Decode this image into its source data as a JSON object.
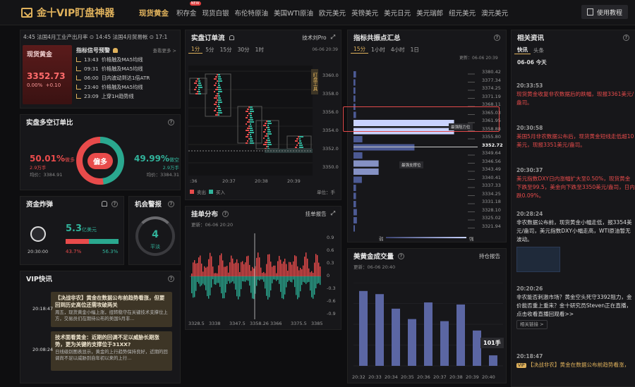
{
  "app": {
    "title": "金十VIP盯盘神器",
    "tutorial": "使用教程"
  },
  "nav": {
    "tabs": [
      {
        "label": "现货黄金",
        "active": true
      },
      {
        "label": "积存金",
        "new": "NEW"
      },
      {
        "label": "现货白银"
      },
      {
        "label": "布伦特原油"
      },
      {
        "label": "美国WTI原油"
      },
      {
        "label": "欧元美元"
      },
      {
        "label": "英镑美元"
      },
      {
        "label": "美元日元"
      },
      {
        "label": "美元瑞郎"
      },
      {
        "label": "纽元美元"
      },
      {
        "label": "澳元美元"
      }
    ]
  },
  "ticker": {
    "text": "4:45 法国4月工业产出月率  ⊙ 14:45 法国4月贸易帐  ⊙ 17:1"
  },
  "gold": {
    "title": "现货黄金",
    "price": "3352.73",
    "change_pct": "0.00%",
    "change": "+0.10"
  },
  "signals": {
    "title": "指标信号预警",
    "more": "查看更多 >",
    "items": [
      {
        "time": "13:43",
        "text": "价格触及MA5均线"
      },
      {
        "time": "09:31",
        "text": "价格触及MA5均线"
      },
      {
        "time": "06:00",
        "text": "日内波动到达1倍ATR"
      },
      {
        "time": "23:40",
        "text": "价格触及MA5均线"
      },
      {
        "time": "23:09",
        "text": "上穿1H趋势线"
      }
    ]
  },
  "longshort": {
    "title": "实盘多空订单比",
    "long_pct": "50.01%",
    "long_label": "做多",
    "long_amount": "2.9万手",
    "long_avg": "均价：3384.91",
    "short_pct": "49.99%",
    "short_label": "做空",
    "short_amount": "2.9万手",
    "short_avg": "均价：3384.31",
    "center": "偏多",
    "long_ratio": 50.01
  },
  "fund": {
    "title": "资金炸弹",
    "amount": "5.3",
    "unit": "亿美元",
    "time": "20:30:00",
    "sell_pct": "43.7%",
    "buy_pct": "56.3%",
    "buy_ratio": 56.3
  },
  "alert": {
    "title": "机会警报",
    "value": "4",
    "label": "平淡"
  },
  "vip": {
    "title": "VIP快讯",
    "items": [
      {
        "time": "20:18:47",
        "title": "【决战非农】黄金在数据公布前趋势看涨，但要回到历史高位还需攻破两关",
        "text": "周五，现货黄金小幅上涨，扭转稳守在关键技术支撑位上方，交易员们在期待公布的美国5月非..."
      },
      {
        "time": "20:08:24",
        "title": "技术面看黄金：近期的回调不足以威胁长期涨势，更为关键的支撑位于31XX?",
        "text": "日线级别图表显示，黄金的上行趋势保持良好，近期的回调尚不足以威胁到自年初以来的上行..."
      }
    ]
  },
  "orderflow": {
    "title": "实盘订单流",
    "tool": "技术刘Pro",
    "date": "06-06 20:39",
    "tabs": [
      "1分",
      "5分",
      "15分",
      "30分",
      "1时"
    ],
    "prices": [
      "3360.0",
      "3358.0",
      "3356.0",
      "3354.0",
      "3352.0",
      "3350.0"
    ],
    "times": [
      ":36",
      "20:37",
      "20:38",
      "20:39"
    ],
    "legend_sell": "卖出",
    "legend_buy": "买入",
    "unit": "单位：手",
    "side_tag": "盯盘工具"
  },
  "resist": {
    "title": "指标共振点汇总",
    "tabs": [
      "15分",
      "1小时",
      "4小时",
      "1日"
    ],
    "updated": "更新：06-06 20:39",
    "levels": [
      "3380.42",
      "3377.34",
      "3374.25",
      "3371.19",
      "3368.11",
      "3365.03",
      "3361.95",
      "3358.88",
      "3355.80",
      "3352.72",
      "3349.64",
      "3346.56",
      "3343.49",
      "3340.41",
      "3337.33",
      "3334.25",
      "3331.18",
      "3328.10",
      "3325.02",
      "3321.94"
    ],
    "current": "3352.72",
    "resist_label": "最强阻力位",
    "support_label": "最强支撑位",
    "weak": "弱",
    "strong": "强"
  },
  "distribution": {
    "title": "挂单分布",
    "report": "挂单报告",
    "updated": "更新：06-06 20:20",
    "y_labels": [
      "0.9",
      "0.6",
      "0.3",
      "0",
      "-0.3",
      "-0.6",
      "-0.9"
    ],
    "x_labels": [
      "3328.5",
      "3338",
      "3347.5",
      "3358.26",
      "3366",
      "3375.5",
      "3385"
    ]
  },
  "volume": {
    "title": "美黄金成交量",
    "report": "持仓报告",
    "updated": "更新：06-06 20:40",
    "x_labels": [
      "20:32",
      "20:33",
      "20:34",
      "20:35",
      "20:36",
      "20:37",
      "20:38",
      "20:39",
      "20:40"
    ],
    "values": [
      720,
      690,
      550,
      450,
      610,
      430,
      590,
      340,
      101
    ],
    "last_label": "101手"
  },
  "news": {
    "title": "相关资讯",
    "tabs": [
      "快讯",
      "头条"
    ],
    "date": "06-06 今天",
    "items": [
      {
        "time": "20:33:53",
        "text": "现货黄金收复非农数据后的跌幅，现报3361美元/盎司。",
        "color": "red"
      },
      {
        "time": "20:30:58",
        "text": "美国5月非农数据公布后，现货黄金短线走低超10美元，现报3351美元/盎司。",
        "color": "red"
      },
      {
        "time": "20:30:37",
        "text": "美元指数DXY日内涨幅扩大至0.50%，现货黄金下跌至99.5，美金向下跌至3350美元/盎司，日内跌0.09%。",
        "color": "red"
      },
      {
        "time": "20:28:24",
        "text": "非农数据公布前，现货黄金小幅走低，报3354美元/盎司，美元指数DXY小幅走高，WTI原油暂无波动。",
        "color": "normal"
      },
      {
        "time": "20:20:26",
        "text": "非农能否刺激市场？黄金空头死守3392阻力，金价能否重上重来？金十研究员Steven正在直播，点击收看直播回观看>>",
        "color": "normal",
        "link": "相关链接 >"
      },
      {
        "time": "20:18:47",
        "text": "【决战非农】黄金在数据公布前趋势看涨，",
        "color": "gold",
        "badge": "VIP"
      }
    ]
  },
  "colors": {
    "accent": "#e0b25c",
    "red": "#e84b4b",
    "green": "#31b39b",
    "bar": "#4c5a94"
  }
}
